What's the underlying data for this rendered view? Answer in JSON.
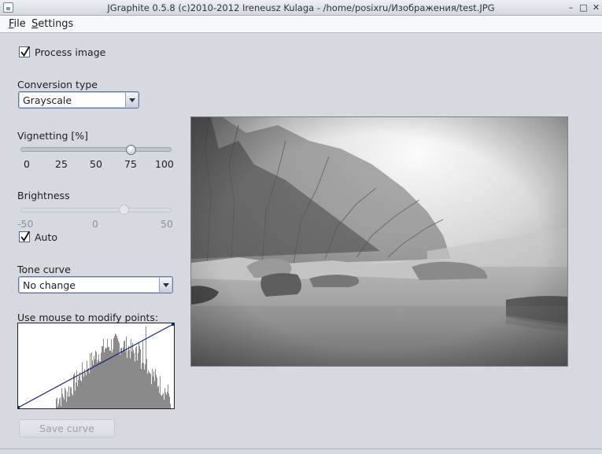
{
  "window": {
    "title": "JGraphite 0.5.8 (c)2010-2012 Ireneusz Kulaga - /home/posixru/Изображения/test.JPG",
    "minimize_glyph": "–",
    "maximize_glyph": "□",
    "close_glyph": "✕"
  },
  "menu": {
    "file_mnemonic": "F",
    "file_rest": "ile",
    "settings_mnemonic": "S",
    "settings_rest": "ettings"
  },
  "process_image": {
    "label": "Process image",
    "checked": true
  },
  "conversion": {
    "label": "Conversion type",
    "selected": "Grayscale"
  },
  "vignetting": {
    "label": "Vignetting [%]",
    "value": 75,
    "min": 0,
    "max": 100,
    "ticks": [
      "0",
      "25",
      "50",
      "75",
      "100"
    ]
  },
  "brightness": {
    "label": "Brightness",
    "value": 20,
    "min": -50,
    "max": 50,
    "enabled": false,
    "ticks": [
      "-50",
      "0",
      "50"
    ]
  },
  "auto": {
    "label": "Auto",
    "checked": true
  },
  "tone_curve": {
    "label": "Tone curve",
    "selected": "No change"
  },
  "curve_editor": {
    "label": "Use mouse to modify points:",
    "curve_color": "#1a237e",
    "histogram_color": "#8a8a8a"
  },
  "save_curve": {
    "label": "Save curve",
    "enabled": false
  },
  "preview": {
    "icon": "grayscale-landscape-preview"
  }
}
